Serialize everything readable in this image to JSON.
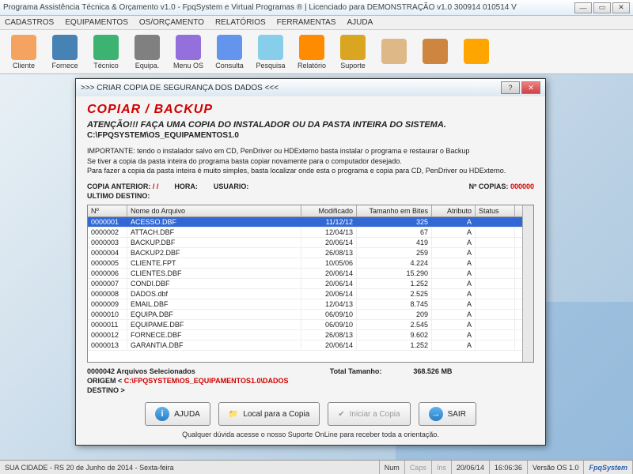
{
  "titlebar": "Programa Assistência Técnica & Orçamento v1.0 - FpqSystem e Virtual Programas ® | Licenciado para  DEMONSTRAÇÃO v1.0 300914 010514 V",
  "menu": [
    "CADASTROS",
    "EQUIPAMENTOS",
    "OS/ORÇAMENTO",
    "RELATÓRIOS",
    "FERRAMENTAS",
    "AJUDA"
  ],
  "toolbar": [
    {
      "label": "Cliente",
      "color": "#f4a460"
    },
    {
      "label": "Fornece",
      "color": "#4682b4"
    },
    {
      "label": "Técnico",
      "color": "#3cb371"
    },
    {
      "label": "Equipa.",
      "color": "#808080"
    },
    {
      "label": "Menu OS",
      "color": "#9370db"
    },
    {
      "label": "Consulta",
      "color": "#6495ed"
    },
    {
      "label": "Pesquisa",
      "color": "#87ceeb"
    },
    {
      "label": "Relatório",
      "color": "#ff8c00"
    },
    {
      "label": "Suporte",
      "color": "#daa520"
    },
    {
      "label": "",
      "color": "#deb887"
    },
    {
      "label": "",
      "color": "#cd853f"
    },
    {
      "label": "",
      "color": "#ffa500"
    }
  ],
  "dialog": {
    "title": ">>> CRIAR COPIA DE SEGURANÇA DOS DADOS <<<",
    "header": "COPIAR / BACKUP",
    "attention": "ATENÇÃO!!!   FAÇA UMA COPIA DO INSTALADOR OU DA PASTA INTEIRA DO SISTEMA.",
    "path": "C:\\FPQSYSTEM\\OS_EQUIPAMENTOS1.0",
    "info1": "IMPORTANTE: tendo o instalador salvo em CD, PenDriver ou HDExterno basta instalar o programa e restaurar o Backup",
    "info2": "Se tiver a copia da pasta inteira do programa basta copiar novamente para o computador desejado.",
    "info3": "Para fazer a copia da pasta inteira é muito simples, basta localizar onde esta o programa e copia para CD, PenDriver ou HDExterno.",
    "meta": {
      "copia_anterior_label": "COPIA ANTERIOR:",
      "copia_anterior": "/   /",
      "hora_label": "HORA:",
      "hora": "",
      "usuario_label": "USUARIO:",
      "usuario": "",
      "ncopias_label": "Nº COPIAS:",
      "ncopias": "000000",
      "ultimo_destino_label": "ULTIMO DESTINO:"
    },
    "columns": [
      "Nº",
      "Nome do Arquivo",
      "Modificado",
      "Tamanho em Bites",
      "Atributo",
      "Status"
    ],
    "rows": [
      {
        "n": "0000001",
        "name": "ACESSO.DBF",
        "mod": "11/12/12",
        "size": "325",
        "attr": "A",
        "status": ""
      },
      {
        "n": "0000002",
        "name": "ATTACH.DBF",
        "mod": "12/04/13",
        "size": "67",
        "attr": "A",
        "status": ""
      },
      {
        "n": "0000003",
        "name": "BACKUP.DBF",
        "mod": "20/06/14",
        "size": "419",
        "attr": "A",
        "status": ""
      },
      {
        "n": "0000004",
        "name": "BACKUP2.DBF",
        "mod": "26/08/13",
        "size": "259",
        "attr": "A",
        "status": ""
      },
      {
        "n": "0000005",
        "name": "CLIENTE.FPT",
        "mod": "10/05/06",
        "size": "4.224",
        "attr": "A",
        "status": ""
      },
      {
        "n": "0000006",
        "name": "CLIENTES.DBF",
        "mod": "20/06/14",
        "size": "15.290",
        "attr": "A",
        "status": ""
      },
      {
        "n": "0000007",
        "name": "CONDI.DBF",
        "mod": "20/06/14",
        "size": "1.252",
        "attr": "A",
        "status": ""
      },
      {
        "n": "0000008",
        "name": "DADOS.dbf",
        "mod": "20/06/14",
        "size": "2.525",
        "attr": "A",
        "status": ""
      },
      {
        "n": "0000009",
        "name": "EMAIL.DBF",
        "mod": "12/04/13",
        "size": "8.745",
        "attr": "A",
        "status": ""
      },
      {
        "n": "0000010",
        "name": "EQUIPA.DBF",
        "mod": "06/09/10",
        "size": "209",
        "attr": "A",
        "status": ""
      },
      {
        "n": "0000011",
        "name": "EQUIPAME.DBF",
        "mod": "06/09/10",
        "size": "2.545",
        "attr": "A",
        "status": ""
      },
      {
        "n": "0000012",
        "name": "FORNECE.DBF",
        "mod": "26/08/13",
        "size": "9.602",
        "attr": "A",
        "status": ""
      },
      {
        "n": "0000013",
        "name": "GARANTIA.DBF",
        "mod": "20/06/14",
        "size": "1.252",
        "attr": "A",
        "status": ""
      }
    ],
    "summary_count_label": "0000042 Arquivos Selecionados",
    "summary_size_label": "Total Tamanho:",
    "summary_size": "368.526 MB",
    "origem_label": "ORIGEM  <",
    "origem_path": "C:\\FPQSYSTEM\\OS_EQUIPAMENTOS1.0\\DADOS",
    "destino_label": "DESTINO >",
    "buttons": {
      "ajuda": "AJUDA",
      "local": "Local para a Copia",
      "iniciar": "Iniciar a Copia",
      "sair": "SAIR"
    },
    "footer": "Qualquer dúvida acesse o nosso Suporte OnLine para receber toda a orientação."
  },
  "statusbar": {
    "city": "SUA CIDADE - RS 20 de Junho de 2014 - Sexta-feira",
    "num": "Num",
    "caps": "Caps",
    "ins": "Ins",
    "date": "20/06/14",
    "time": "16:06:36",
    "version": "Versão OS 1.0",
    "brand": "FpqSystem"
  }
}
